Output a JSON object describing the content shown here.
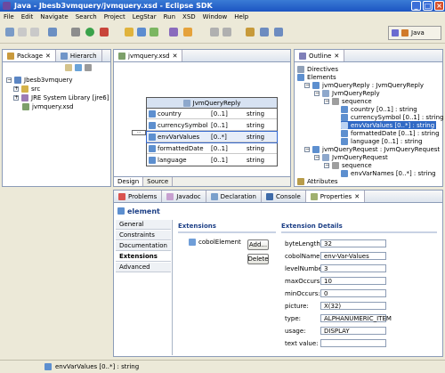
{
  "window": {
    "title": "Java - Jbesb3vmquery/jvmquery.xsd - Eclipse SDK"
  },
  "menu": [
    "File",
    "Edit",
    "Navigate",
    "Search",
    "Project",
    "LegStar",
    "Run",
    "XSD",
    "Window",
    "Help"
  ],
  "toolbar": {
    "perspective_label": "Java"
  },
  "package_explorer": {
    "tabs": [
      "Package",
      "Hierarch"
    ],
    "tree": [
      {
        "label": "Jbesb3vmquery",
        "level": 0,
        "icon": "project-icon"
      },
      {
        "label": "src",
        "level": 1,
        "icon": "folder-icon"
      },
      {
        "label": "JRE System Library [jre6]",
        "level": 1,
        "icon": "library-icon"
      },
      {
        "label": "jvmquery.xsd",
        "level": 1,
        "icon": "xsd-file-icon"
      }
    ]
  },
  "editor": {
    "tab_label": "jvmquery.xsd",
    "complex_type": "JvmQueryReply",
    "rows": [
      {
        "name": "country",
        "occurs": "[0..1]",
        "type": "string"
      },
      {
        "name": "currencySymbol",
        "occurs": "[0..1]",
        "type": "string"
      },
      {
        "name": "envVarValues",
        "occurs": "[0..*]",
        "type": "string"
      },
      {
        "name": "formattedDate",
        "occurs": "[0..1]",
        "type": "string"
      },
      {
        "name": "language",
        "occurs": "[0..1]",
        "type": "string"
      }
    ],
    "bottom_tabs": [
      "Design",
      "Source"
    ]
  },
  "outline": {
    "tab_label": "Outline",
    "tree": [
      {
        "label": "Directives",
        "level": 0
      },
      {
        "label": "Elements",
        "level": 0
      },
      {
        "label": "jvmQueryReply : JvmQueryReply",
        "level": 1
      },
      {
        "label": "JvmQueryReply",
        "level": 2
      },
      {
        "label": "sequence",
        "level": 3
      },
      {
        "label": "country [0..1] : string",
        "level": 4
      },
      {
        "label": "currencySymbol [0..1] : string",
        "level": 4
      },
      {
        "label": "envVarValues [0..*] : string",
        "level": 4,
        "selected": true
      },
      {
        "label": "formattedDate [0..1] : string",
        "level": 4
      },
      {
        "label": "language [0..1] : string",
        "level": 4
      },
      {
        "label": "jvmQueryRequest : JvmQueryRequest",
        "level": 1
      },
      {
        "label": "JvmQueryRequest",
        "level": 2
      },
      {
        "label": "sequence",
        "level": 3
      },
      {
        "label": "envVarNames [0..*] : string",
        "level": 4
      },
      {
        "label": "Attributes",
        "level": 0
      }
    ]
  },
  "bottom_panel": {
    "tabs": [
      "Problems",
      "Javadoc",
      "Declaration",
      "Console",
      "Properties"
    ],
    "heading": "element",
    "side_tabs": [
      "General",
      "Constraints",
      "Documentation",
      "Extensions",
      "Advanced"
    ],
    "extensions_title": "Extensions",
    "extension_item": "cobolElement",
    "add_label": "Add...",
    "delete_label": "Delete",
    "details_title": "Extension Details",
    "details": [
      {
        "label": "byteLength:",
        "value": "32"
      },
      {
        "label": "cobolName:",
        "value": "env-Var-Values"
      },
      {
        "label": "levelNumber:",
        "value": "3"
      },
      {
        "label": "maxOccurs:",
        "value": "10"
      },
      {
        "label": "minOccurs:",
        "value": "0"
      },
      {
        "label": "picture:",
        "value": "X(32)"
      },
      {
        "label": "type:",
        "value": "ALPHANUMERIC_ITEM"
      },
      {
        "label": "usage:",
        "value": "DISPLAY"
      },
      {
        "label": "text value:",
        "value": ""
      }
    ]
  },
  "status": {
    "text": "envVarValues [0..*] : string"
  }
}
